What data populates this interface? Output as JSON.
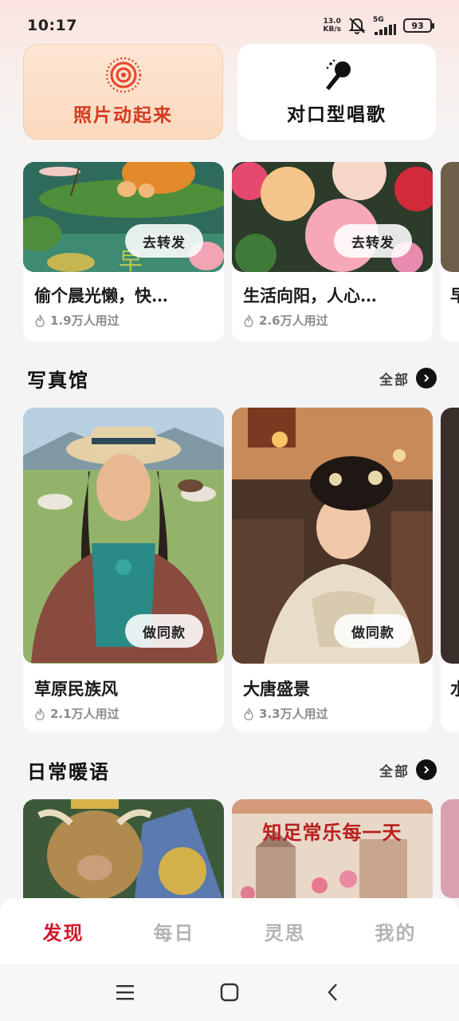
{
  "status_bar": {
    "time": "10:17",
    "net_speed_value": "13.0",
    "net_speed_unit": "KB/s",
    "network": "5G",
    "battery": "93"
  },
  "features": [
    {
      "label": "照片动起来",
      "icon": "target-rings-icon"
    },
    {
      "label": "对口型唱歌",
      "icon": "microphone-icon"
    }
  ],
  "top_cards": [
    {
      "title": "偷个晨光懒，快…",
      "uses": "1.9万人用过",
      "button": "去转发"
    },
    {
      "title": "生活向阳，人心…",
      "uses": "2.6万人用过",
      "button": "去转发"
    },
    {
      "title": "早",
      "uses": ""
    }
  ],
  "sections": [
    {
      "title": "写真馆",
      "see_all": "全部",
      "cards": [
        {
          "title": "草原民族风",
          "uses": "2.1万人用过",
          "button": "做同款"
        },
        {
          "title": "大唐盛景",
          "uses": "3.3万人用过",
          "button": "做同款"
        },
        {
          "title": "水",
          "uses": ""
        }
      ]
    },
    {
      "title": "日常暖语",
      "see_all": "全部",
      "cards": [
        {
          "title": "",
          "image_text": ""
        },
        {
          "title": "",
          "image_text": "知足常乐每一天"
        }
      ]
    }
  ],
  "bottom_nav": [
    {
      "label": "发现",
      "active": true
    },
    {
      "label": "每日",
      "active": false
    },
    {
      "label": "灵思",
      "active": false
    },
    {
      "label": "我的",
      "active": false
    }
  ],
  "colors": {
    "accent_red": "#d1192d",
    "feature_red": "#d33a20",
    "inactive_gray": "#b3b3b3"
  }
}
